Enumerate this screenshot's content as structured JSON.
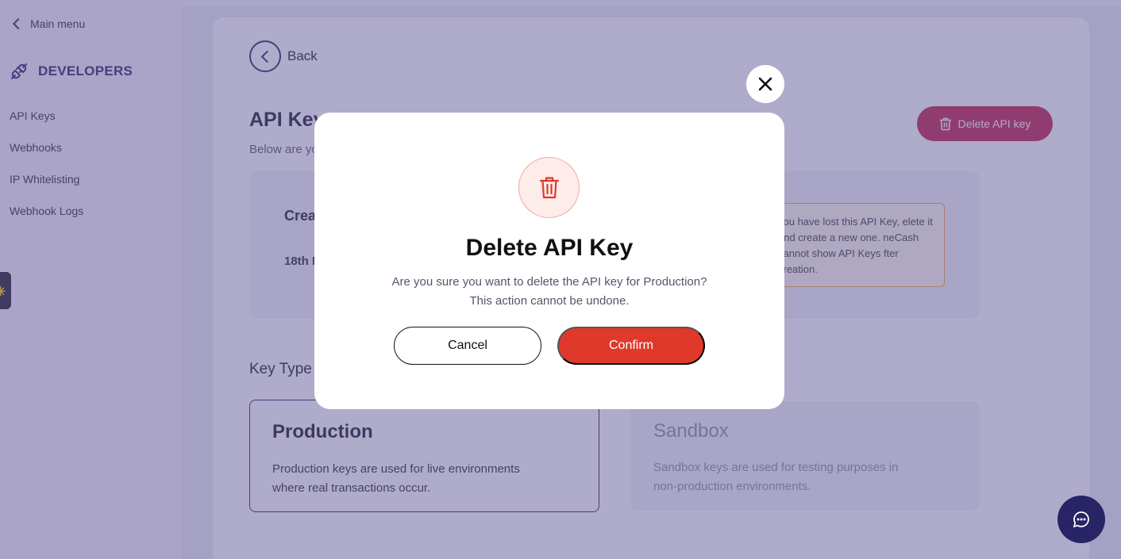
{
  "sidebar": {
    "main_menu": "Main menu",
    "section_title": "DEVELOPERS",
    "items": [
      {
        "label": "API Keys"
      },
      {
        "label": "Webhooks"
      },
      {
        "label": "IP Whitelisting"
      },
      {
        "label": "Webhook Logs"
      }
    ]
  },
  "page": {
    "back": "Back",
    "title": "API Key",
    "subtitle": "Below are yo",
    "delete_button": "Delete API key",
    "created_label": "Created",
    "created_date": "18th M",
    "warning": "you have lost this API Key, elete it and create a new one. neCash cannot show API Keys fter creation.",
    "key_type_label": "Key Type",
    "key_types": [
      {
        "title": "Production",
        "desc": "Production keys are used for live environments where real transactions occur."
      },
      {
        "title": "Sandbox",
        "desc": "Sandbox keys are used for testing purposes in non-production environments."
      }
    ]
  },
  "modal": {
    "title": "Delete API Key",
    "message_line1": "Are you sure you want to delete the API key for Production?",
    "message_line2": "This action cannot be undone.",
    "cancel": "Cancel",
    "confirm": "Confirm",
    "icon": "trash-icon"
  },
  "colors": {
    "brand": "#282466",
    "danger": "#e0392b",
    "delete_button": "#c2204a"
  }
}
